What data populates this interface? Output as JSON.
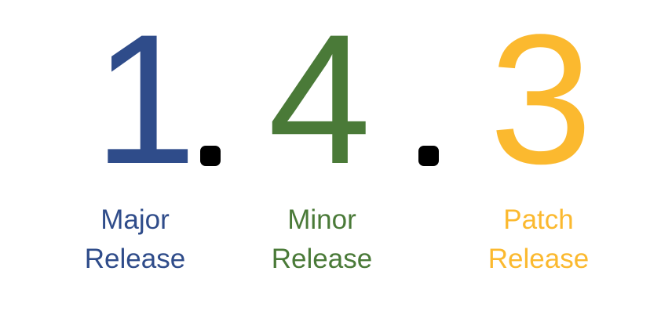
{
  "version": {
    "major": "1",
    "minor": "4",
    "patch": "3",
    "separator": "."
  },
  "labels": {
    "major": {
      "line1": "Major",
      "line2": "Release"
    },
    "minor": {
      "line1": "Minor",
      "line2": "Release"
    },
    "patch": {
      "line1": "Patch",
      "line2": "Release"
    }
  },
  "colors": {
    "major": "#2f4c8a",
    "minor": "#4a7a38",
    "patch": "#fbb92f",
    "separator": "#000000"
  }
}
